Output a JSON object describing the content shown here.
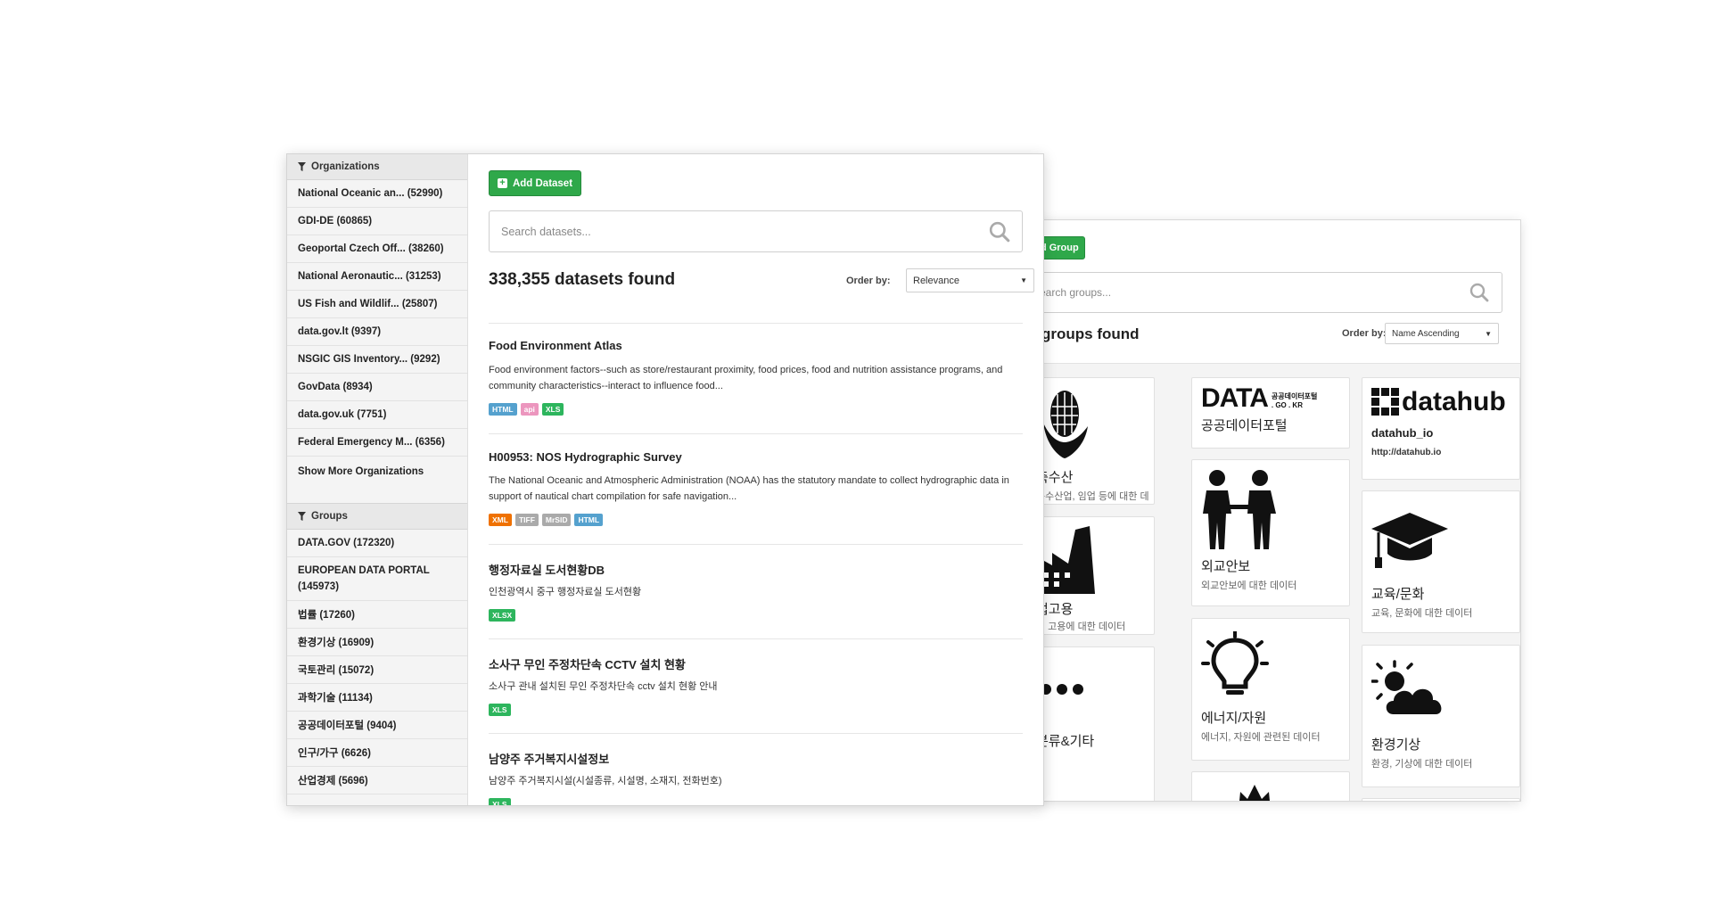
{
  "groups_panel": {
    "add_button": "Add Group",
    "search_placeholder": "earch groups...",
    "found_text": "groups found",
    "order_label": "Order by:",
    "order_value": "Name Ascending",
    "cards": [
      {
        "title": "축수산",
        "desc": "축수산업, 임업 등에 대한 데",
        "icon": "corn-icon"
      },
      {
        "title": "업고용",
        "desc": "업 고용에 대한 데이터",
        "icon": "factory-icon"
      },
      {
        "title": "분류&기타",
        "icon": "dots-icon"
      },
      {
        "logo_word": "DATA",
        "logo_small_1": "공공데이터포털",
        "logo_small_2": ". GO . KR",
        "title": "공공데이터포털",
        "icon": "data-go-kr-logo"
      },
      {
        "title": "외교안보",
        "desc": "외교안보에 대한 데이터",
        "icon": "people-icon"
      },
      {
        "title": "에너지/자원",
        "desc": "에너지, 자원에 관련된 데이터",
        "icon": "lightbulb-icon"
      },
      {
        "icon": "crown-icon"
      },
      {
        "logo_word": "datahub",
        "title": "datahub_io",
        "desc": "http://datahub.io",
        "icon": "datahub-logo"
      },
      {
        "title": "교육/문화",
        "desc": "교육, 문화에 대한 데이터",
        "icon": "graduation-cap-icon"
      },
      {
        "title": "환경기상",
        "desc": "환경, 기상에 대한 데이터",
        "icon": "weather-icon"
      }
    ]
  },
  "datasets_panel": {
    "sidebar": {
      "organizations_heading": "Organizations",
      "organizations": [
        "National Oceanic an... (52990)",
        "GDI-DE (60865)",
        "Geoportal Czech Off... (38260)",
        "National Aeronautic... (31253)",
        "US Fish and Wildlif... (25807)",
        "data.gov.lt (9397)",
        "NSGIC GIS Inventory... (9292)",
        "GovData (8934)",
        "data.gov.uk (7751)",
        "Federal Emergency M... (6356)"
      ],
      "show_more": "Show More Organizations",
      "groups_heading": "Groups",
      "groups": [
        "DATA.GOV (172320)",
        "EUROPEAN DATA PORTAL (145973)",
        "법률 (17260)",
        "환경기상 (16909)",
        "국토관리 (15072)",
        "과학기술 (11134)",
        "공공데이터포털 (9404)",
        "인구/가구 (6626)",
        "산업경제 (5696)"
      ]
    },
    "add_button": "Add Dataset",
    "search_placeholder": "Search datasets...",
    "found_text": "338,355 datasets found",
    "order_label": "Order by:",
    "order_value": "Relevance",
    "datasets": [
      {
        "title": "Food Environment Atlas",
        "desc": "Food environment factors--such as store/restaurant proximity, food prices, food and nutrition assistance programs, and community characteristics--interact to influence food...",
        "badges": [
          {
            "label": "HTML",
            "color": "#55a1ce"
          },
          {
            "label": "api",
            "color": "#ec96be"
          },
          {
            "label": "XLS",
            "color": "#2db55d"
          }
        ]
      },
      {
        "title": "H00953: NOS Hydrographic Survey",
        "desc": "The National Oceanic and Atmospheric Administration (NOAA) has the statutory mandate to collect hydrographic data in support of nautical chart compilation for safe navigation...",
        "badges": [
          {
            "label": "XML",
            "color": "#ef7100"
          },
          {
            "label": "TIFF",
            "color": "#aaaaaa"
          },
          {
            "label": "MrSID",
            "color": "#aaaaaa"
          },
          {
            "label": "HTML",
            "color": "#55a1ce"
          }
        ]
      },
      {
        "title": "행정자료실 도서현황DB",
        "desc": "인천광역시 중구 행정자료실 도서현황",
        "badges": [
          {
            "label": "XLSX",
            "color": "#2db55d"
          }
        ]
      },
      {
        "title": "소사구 무인 주정차단속 CCTV 설치 현황",
        "desc": "소사구 관내 설치된 무인 주정차단속 cctv 설치 현황 안내",
        "badges": [
          {
            "label": "XLS",
            "color": "#2db55d"
          }
        ]
      },
      {
        "title": "남양주 주거복지시설정보",
        "desc": "남양주 주거복지시설(시설종류, 시설명, 소재지, 전화번호)",
        "badges": [
          {
            "label": "XLS",
            "color": "#2db55d"
          }
        ]
      }
    ]
  }
}
